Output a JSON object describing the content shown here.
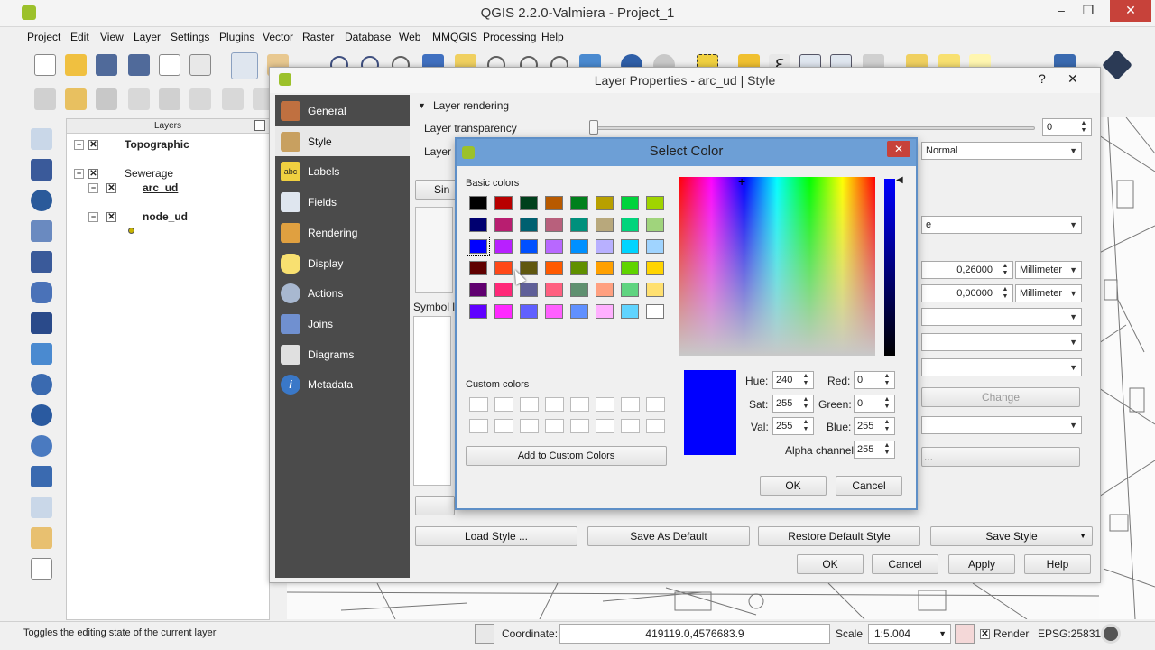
{
  "app": {
    "title": "QGIS 2.2.0-Valmiera - Project_1"
  },
  "menu": [
    "Project",
    "Edit",
    "View",
    "Layer",
    "Settings",
    "Plugins",
    "Vector",
    "Raster",
    "Database",
    "Web",
    "MMQGIS",
    "Processing",
    "Help"
  ],
  "layers_panel": {
    "title": "Layers",
    "items": [
      "Topographic",
      "Sewerage",
      "arc_ud",
      "node_ud"
    ]
  },
  "layer_props": {
    "title": "Layer Properties - arc_ud | Style",
    "nav": [
      {
        "label": "General",
        "icon": "tools-icon"
      },
      {
        "label": "Style",
        "icon": "brush-icon"
      },
      {
        "label": "Labels",
        "icon": "abc-icon"
      },
      {
        "label": "Fields",
        "icon": "table-icon"
      },
      {
        "label": "Rendering",
        "icon": "paintbrush-icon"
      },
      {
        "label": "Display",
        "icon": "speech-bubble-icon"
      },
      {
        "label": "Actions",
        "icon": "gear-icon"
      },
      {
        "label": "Joins",
        "icon": "join-icon"
      },
      {
        "label": "Diagrams",
        "icon": "diagram-icon"
      },
      {
        "label": "Metadata",
        "icon": "info-icon"
      }
    ],
    "layer_rendering": "Layer rendering",
    "transparency_label": "Layer transparency",
    "transparency_value": "0",
    "blend_label": "Layer",
    "blend_mode": "Normal",
    "renderer_tab": "Sin",
    "width_value": "0,26000",
    "offset_value": "0,00000",
    "unit": "Millimeter",
    "symbol_label": "Symbol l",
    "change": "Change",
    "dots": "...",
    "fragment_e": "e",
    "buttons": {
      "load": "Load Style ...",
      "save_default": "Save As Default",
      "restore": "Restore Default Style",
      "save": "Save Style",
      "ok": "OK",
      "cancel": "Cancel",
      "apply": "Apply",
      "help": "Help"
    }
  },
  "select_color": {
    "title": "Select Color",
    "basic_label": "Basic colors",
    "custom_label": "Custom colors",
    "add_custom": "Add to Custom Colors",
    "basic_colors": [
      [
        "#000000",
        "#b80000",
        "#00401c",
        "#b85a00",
        "#00801c",
        "#b8a000",
        "#00d43c",
        "#a0d400"
      ],
      [
        "#000070",
        "#b81e70",
        "#006070",
        "#b8607c",
        "#00907c",
        "#b8a87c",
        "#00d47c",
        "#a0d47c"
      ],
      [
        "#0000ff",
        "#b820ff",
        "#0050ff",
        "#b868ff",
        "#0090ff",
        "#b8b0ff",
        "#00d4ff",
        "#a0d4ff"
      ],
      [
        "#600000",
        "#ff4818",
        "#605810",
        "#ff5a00",
        "#609000",
        "#ffa000",
        "#60d400",
        "#ffd400"
      ],
      [
        "#600070",
        "#ff2878",
        "#606098",
        "#ff6080",
        "#609070",
        "#ffa080",
        "#60d480",
        "#ffe070"
      ],
      [
        "#6000ff",
        "#ff28ff",
        "#6060ff",
        "#ff60ff",
        "#6090ff",
        "#ffb0ff",
        "#60d4ff",
        "#ffffff"
      ]
    ],
    "selected_color": "#0000ff",
    "hue_label": "Hue:",
    "hue": "240",
    "sat_label": "Sat:",
    "sat": "255",
    "val_label": "Val:",
    "val": "255",
    "red_label": "Red:",
    "red": "0",
    "green_label": "Green:",
    "green": "0",
    "blue_label": "Blue:",
    "blue": "255",
    "alpha_label": "Alpha channel:",
    "alpha": "255",
    "ok": "OK",
    "cancel": "Cancel"
  },
  "status": {
    "message": "Toggles the editing state of the current layer",
    "coord_label": "Coordinate:",
    "coord": "419119.0,4576683.9",
    "scale_label": "Scale",
    "scale": "1:5.004",
    "render": "Render",
    "epsg": "EPSG:25831"
  }
}
